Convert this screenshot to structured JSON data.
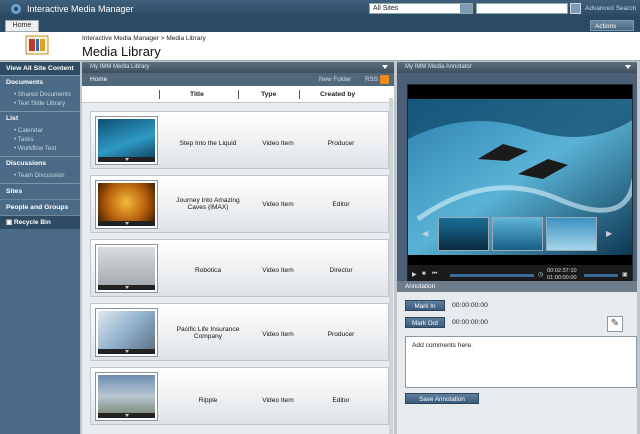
{
  "app": {
    "title": "Interactive Media Manager",
    "site_select": "All Sites",
    "search_placeholder": "",
    "advanced_search": "Advanced Search",
    "tab_home": "Home",
    "actions": "Actions"
  },
  "header": {
    "breadcrumb": "Interactive Media Manager > Media Library",
    "title": "Media Library"
  },
  "nav": {
    "view_all": "View All Site Content",
    "sections": [
      {
        "label": "Documents",
        "items": [
          "Shared Documents",
          "Text Slide Library"
        ]
      },
      {
        "label": "List",
        "items": [
          "Calendar",
          "Tasks",
          "Workflow Test"
        ]
      },
      {
        "label": "Discussions",
        "items": [
          "Team Discussion"
        ]
      },
      {
        "label": "Sites",
        "items": []
      },
      {
        "label": "People and Groups",
        "items": []
      }
    ],
    "recycle_bin": "Recycle Bin"
  },
  "library": {
    "panel_title": "My IMM Media Library",
    "home": "Home",
    "new_folder": "New Folder",
    "rss": "RSS",
    "columns": [
      "Title",
      "Type",
      "Created by"
    ],
    "rows": [
      {
        "title": "Step Into the Liquid",
        "type": "Video Item",
        "created_by": "Producer"
      },
      {
        "title": "Journey Into Amazing Caves (IMAX)",
        "type": "Video Item",
        "created_by": "Editor"
      },
      {
        "title": "Robotica",
        "type": "Video Item",
        "created_by": "Director"
      },
      {
        "title": "Pacific Life Insurance Company",
        "type": "Video Item",
        "created_by": "Producer"
      },
      {
        "title": "Ripple",
        "type": "Video Item",
        "created_by": "Editor"
      }
    ]
  },
  "annotator": {
    "panel_title": "My IMM Media Annotator",
    "timecode_current": "00:02:37:10",
    "timecode_total": "01:00:00:00",
    "annotation_header": "Annotation",
    "mark_in": "Mark In",
    "mark_out": "Mark Out",
    "mark_in_time": "00:00:00:00",
    "mark_out_time": "00:00:00:00",
    "comment": "Add comments here.",
    "save": "Save Annotation"
  }
}
